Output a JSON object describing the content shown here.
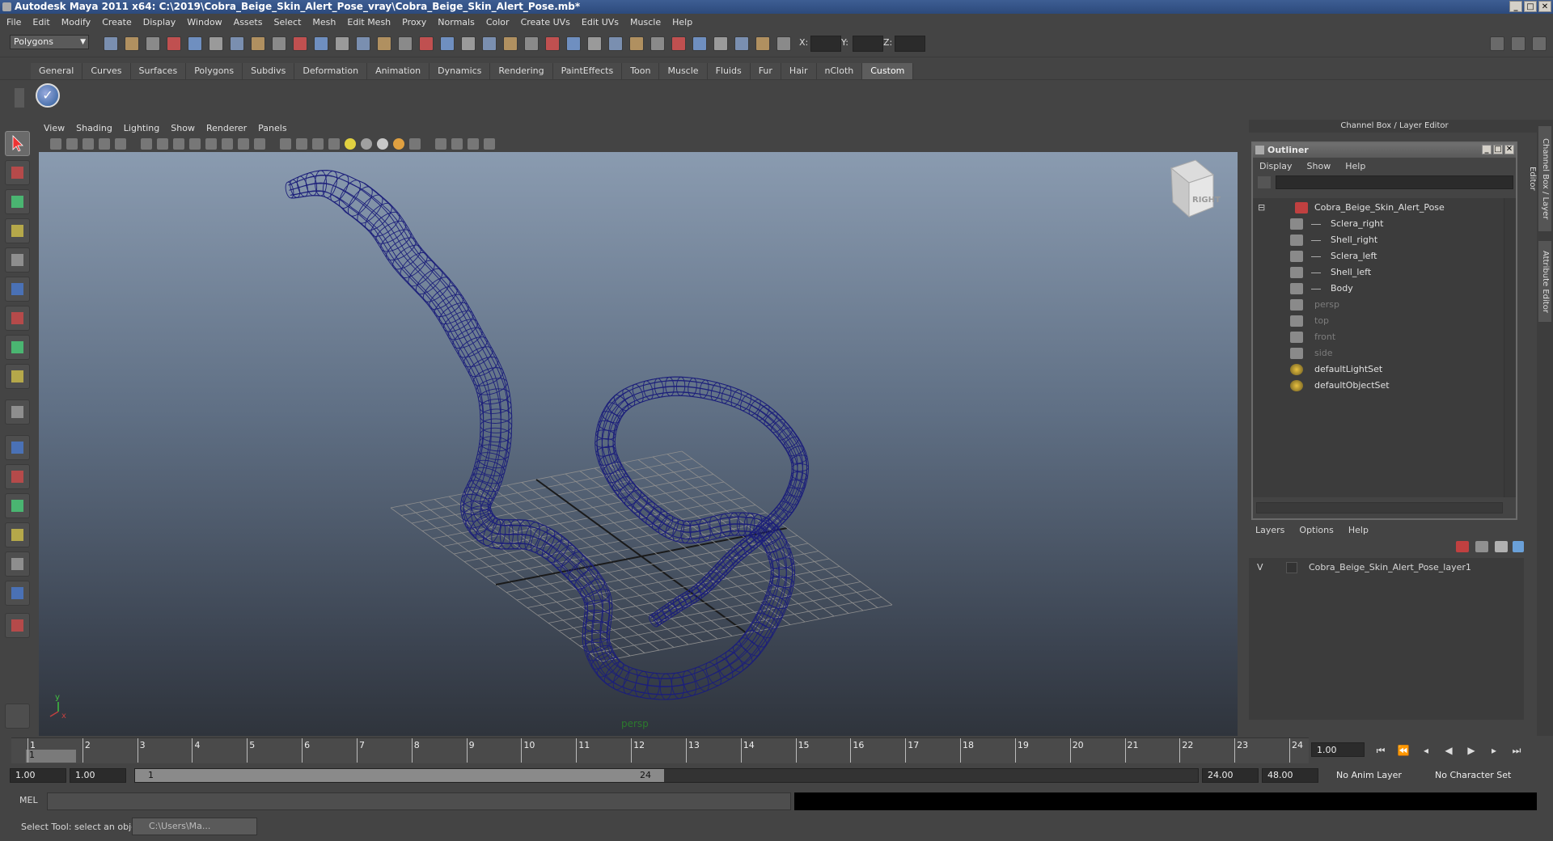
{
  "window": {
    "title": "Autodesk Maya 2011 x64: C:\\2019\\Cobra_Beige_Skin_Alert_Pose_vray\\Cobra_Beige_Skin_Alert_Pose.mb*",
    "minimize": "_",
    "maximize": "□",
    "close": "✕"
  },
  "menu": [
    "File",
    "Edit",
    "Modify",
    "Create",
    "Display",
    "Window",
    "Assets",
    "Select",
    "Mesh",
    "Edit Mesh",
    "Proxy",
    "Normals",
    "Color",
    "Create UVs",
    "Edit UVs",
    "Muscle",
    "Help"
  ],
  "statusline": {
    "mode": "Polygons",
    "x_label": "X:",
    "y_label": "Y:",
    "z_label": "Z:"
  },
  "shelf": {
    "tabs": [
      "General",
      "Curves",
      "Surfaces",
      "Polygons",
      "Subdivs",
      "Deformation",
      "Animation",
      "Dynamics",
      "Rendering",
      "PaintEffects",
      "Toon",
      "Muscle",
      "Fluids",
      "Fur",
      "Hair",
      "nCloth",
      "Custom"
    ],
    "active_tab": "Custom",
    "checkmark": "✓"
  },
  "viewport": {
    "menu": [
      "View",
      "Shading",
      "Lighting",
      "Show",
      "Renderer",
      "Panels"
    ],
    "camera": "persp",
    "viewcube_label": "RIGHT",
    "axis_y": "y",
    "axis_x": "x",
    "wire_color": "#1c1f7a"
  },
  "channel_box": {
    "header": "Channel Box / Layer Editor"
  },
  "outliner": {
    "title": "Outliner",
    "menu": [
      "Display",
      "Show",
      "Help"
    ],
    "items": [
      {
        "label": "Cobra_Beige_Skin_Alert_Pose",
        "indent": 0,
        "dim": false,
        "icon": "group-icon"
      },
      {
        "label": "Sclera_right",
        "indent": 1,
        "dim": false,
        "icon": "mesh-icon"
      },
      {
        "label": "Shell_right",
        "indent": 1,
        "dim": false,
        "icon": "mesh-icon"
      },
      {
        "label": "Sclera_left",
        "indent": 1,
        "dim": false,
        "icon": "mesh-icon"
      },
      {
        "label": "Shell_left",
        "indent": 1,
        "dim": false,
        "icon": "mesh-icon"
      },
      {
        "label": "Body",
        "indent": 1,
        "dim": false,
        "icon": "mesh-icon"
      },
      {
        "label": "persp",
        "indent": 0,
        "dim": true,
        "icon": "camera-icon"
      },
      {
        "label": "top",
        "indent": 0,
        "dim": true,
        "icon": "camera-icon"
      },
      {
        "label": "front",
        "indent": 0,
        "dim": true,
        "icon": "camera-icon"
      },
      {
        "label": "side",
        "indent": 0,
        "dim": true,
        "icon": "camera-icon"
      },
      {
        "label": "defaultLightSet",
        "indent": 0,
        "dim": false,
        "icon": "set-icon"
      },
      {
        "label": "defaultObjectSet",
        "indent": 0,
        "dim": false,
        "icon": "set-icon"
      }
    ]
  },
  "layers": {
    "menu": [
      "Layers",
      "Options",
      "Help"
    ],
    "rows": [
      {
        "visible": "V",
        "name": "Cobra_Beige_Skin_Alert_Pose_layer1"
      }
    ]
  },
  "right_tabs": {
    "tab1": "Channel Box / Layer Editor",
    "tab2": "Attribute Editor"
  },
  "timeline": {
    "start": 1,
    "end": 24,
    "current": 1,
    "current_time": "1.00"
  },
  "range": {
    "start_time": "1.00",
    "anim_start": "1.00",
    "range_start": "1",
    "range_end": "24",
    "anim_end": "24.00",
    "end_time": "48.00",
    "anim_layer": "No Anim Layer",
    "char_set": "No Character Set"
  },
  "command": {
    "label": "MEL"
  },
  "help": {
    "message": "Select Tool: select an object",
    "task": "C:\\Users\\Ma..."
  }
}
